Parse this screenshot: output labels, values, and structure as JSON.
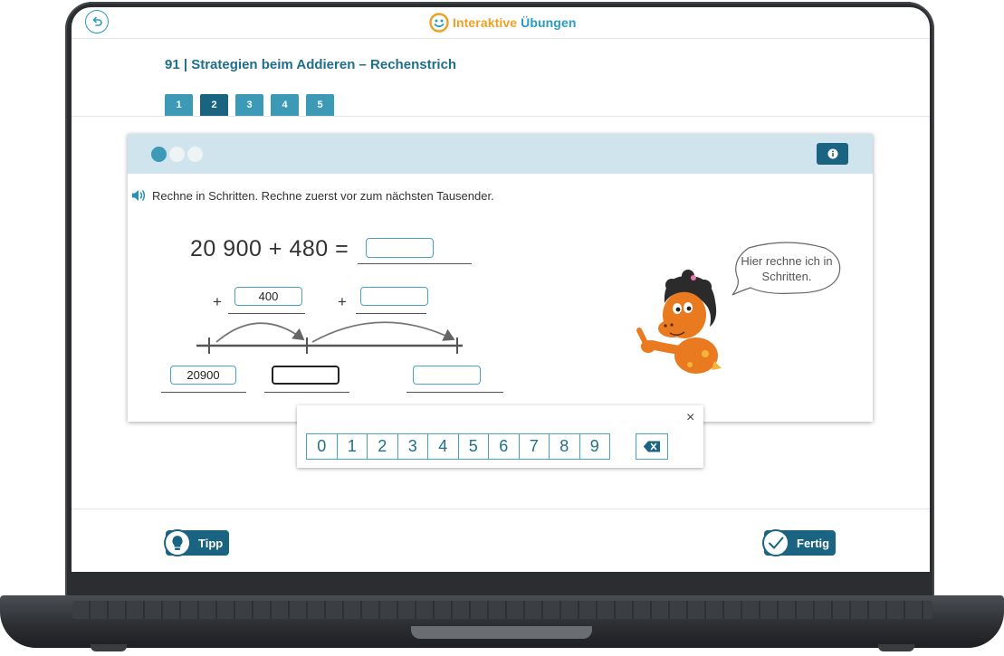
{
  "app": {
    "logo_text_part1": "Interaktive ",
    "logo_text_part2": "Übungen"
  },
  "header": {
    "title": "91 | Strategien beim Addieren – Rechenstrich",
    "tabs": [
      {
        "label": "1"
      },
      {
        "label": "2",
        "active": true
      },
      {
        "label": "3"
      },
      {
        "label": "4"
      },
      {
        "label": "5"
      }
    ]
  },
  "exercise": {
    "progress_steps": 3,
    "progress_current": 1,
    "instruction": "Rechne in Schritten. Rechne zuerst vor zum nächsten Tausender.",
    "equation": "20 900 + 480 =",
    "result_value": "",
    "step1_value": "400",
    "step2_value": "",
    "start_value": "20900",
    "middle_value": "",
    "end_value": "",
    "plus_sign": "+",
    "speech_bubble": "Hier rechne ich in Schritten."
  },
  "keypad": {
    "close_label": "×",
    "digits": [
      "0",
      "1",
      "2",
      "3",
      "4",
      "5",
      "6",
      "7",
      "8",
      "9"
    ]
  },
  "footer": {
    "tip_label": "Tipp",
    "done_label": "Fertig"
  },
  "colors": {
    "primary": "#1a6482",
    "accent": "#3d9ab7",
    "input_border": "#4aa3c4",
    "header_band": "#cfe4ec",
    "logo_orange": "#f0a021"
  }
}
